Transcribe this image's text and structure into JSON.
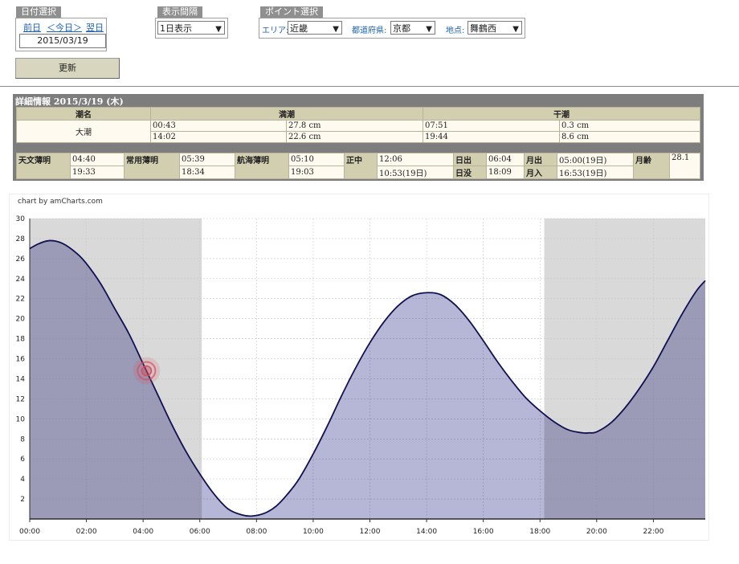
{
  "date_select": {
    "title": "日付選択",
    "prev": "前日",
    "today": "＜今日＞",
    "next": "翌日",
    "date_value": "2015/03/19",
    "update_button": "更新"
  },
  "interval": {
    "title": "表示間隔",
    "selected": "1日表示"
  },
  "point_select": {
    "title": "ポイント選択",
    "area_label": "エリア:",
    "area_value": "近畿",
    "pref_label": "都道府県:",
    "pref_value": "京都",
    "spot_label": "地点:",
    "spot_value": "舞鶴西"
  },
  "detail": {
    "title": "詳細情報  2015/3/19 (木)",
    "tide_name_header": "潮名",
    "high_header": "満潮",
    "low_header": "干潮",
    "tide_name": "大潮",
    "high": [
      {
        "time": "00:43",
        "level": "27.8 cm"
      },
      {
        "time": "14:02",
        "level": "22.6 cm"
      }
    ],
    "low": [
      {
        "time": "07:51",
        "level": "0.3 cm"
      },
      {
        "time": "19:44",
        "level": "8.6 cm"
      }
    ],
    "astro": {
      "astronomical_label": "天文薄明",
      "astronomical": [
        "04:40",
        "19:33"
      ],
      "civil_label": "常用薄明",
      "civil": [
        "05:39",
        "18:34"
      ],
      "nautical_label": "航海薄明",
      "nautical": [
        "05:10",
        "19:03"
      ],
      "transit_label": "正中",
      "transit": [
        "12:06",
        "10:53(19日)"
      ],
      "sunrise_label": "日出",
      "sunrise": "06:04",
      "sunset_label": "日没",
      "sunset": "18:09",
      "moonrise_label": "月出",
      "moonrise": "05:00(19日)",
      "moonset_label": "月入",
      "moonset": "16:53(19日)",
      "moon_age_label": "月齢",
      "moon_age": "28.1"
    }
  },
  "chart_credit": "chart by amCharts.com",
  "chart_data": {
    "type": "area",
    "x_ticks": [
      "00:00",
      "02:00",
      "04:00",
      "06:00",
      "08:00",
      "10:00",
      "12:00",
      "14:00",
      "16:00",
      "18:00",
      "20:00",
      "22:00"
    ],
    "y_ticks": [
      "2",
      "4",
      "6",
      "8",
      "10",
      "12",
      "14",
      "16",
      "18",
      "20",
      "22",
      "24",
      "26",
      "28",
      "30"
    ],
    "ylim": [
      0,
      30
    ],
    "xlim_hours": [
      0,
      23.83
    ],
    "night_bands_hours": [
      [
        0,
        6.07
      ],
      [
        18.15,
        23.83
      ]
    ],
    "series": [
      {
        "x_hours": [
          0,
          0.33,
          0.72,
          1.17,
          1.67,
          2,
          2.5,
          3,
          3.5,
          4,
          4.5,
          5,
          5.5,
          6,
          6.5,
          7,
          7.5,
          7.85,
          8.3,
          8.7,
          9.1,
          9.5,
          10,
          10.5,
          11,
          11.5,
          12,
          12.5,
          13,
          13.5,
          14.03,
          14.5,
          15,
          15.5,
          16,
          16.5,
          17,
          17.5,
          18,
          18.5,
          19,
          19.5,
          19.73,
          20,
          20.5,
          21,
          21.5,
          22,
          22.5,
          23,
          23.5,
          23.83
        ],
        "values": [
          27,
          27.5,
          27.8,
          27.5,
          26.5,
          25.5,
          23.5,
          21,
          18.5,
          15.5,
          12.5,
          9.5,
          6.8,
          4.5,
          2.5,
          1,
          0.4,
          0.3,
          0.6,
          1.3,
          2.5,
          4,
          6.5,
          9.3,
          12.3,
          15.1,
          17.6,
          19.7,
          21.3,
          22.3,
          22.6,
          22.4,
          21.4,
          19.8,
          17.8,
          15.7,
          13.8,
          12.1,
          10.8,
          9.7,
          8.9,
          8.6,
          8.6,
          8.7,
          9.6,
          11.1,
          13,
          15.2,
          17.8,
          20.4,
          22.7,
          23.8
        ],
        "fill_color": "#a9a9d0",
        "line_color": "#111152"
      }
    ],
    "cursor_marker": {
      "x_hours": 4.12,
      "value": 14.8,
      "color": "#d05060"
    },
    "grid": true
  }
}
